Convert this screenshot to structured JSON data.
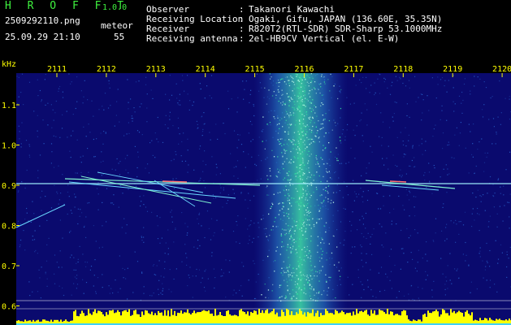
{
  "header": {
    "app_title": "H R O F F T",
    "version": "1.0.0",
    "filename": "2509292110.png",
    "datetime": "25.09.29 21:10",
    "meteor_label": "meteor",
    "meteor_count": "55"
  },
  "info": [
    {
      "label": "Observer",
      "value": "Takanori Kawachi"
    },
    {
      "label": "Receiving Location",
      "value": "Ogaki, Gifu, JAPAN (136.60E, 35.35N)"
    },
    {
      "label": "Receiver",
      "value": "R820T2(RTL-SDR) SDR-Sharp 53.1000MHz"
    },
    {
      "label": "Receiving antenna",
      "value": "2el-HB9CV Vertical (el. E-W)"
    }
  ],
  "spectrogram": {
    "unit": "kHz",
    "x_labels": [
      "2111",
      "2112",
      "2113",
      "2114",
      "2115",
      "2116",
      "2117",
      "2118",
      "2119",
      "2120"
    ],
    "y_labels": [
      "1.1",
      "1.0",
      "0.9",
      "0.8",
      "0.7",
      "0.6"
    ],
    "colors": {
      "background": "#0a0a6e",
      "noise": "#2b6cd6",
      "signal": "#36e3a0",
      "carrier": "#a0f0ff",
      "level_bar": "#ffff00",
      "label": "#ffff00"
    }
  }
}
